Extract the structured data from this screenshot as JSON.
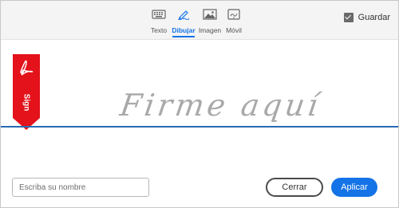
{
  "tabs": [
    {
      "label": "Texto",
      "icon": "keyboard-icon"
    },
    {
      "label": "Dibujar",
      "icon": "pen-icon",
      "active": true
    },
    {
      "label": "Imagen",
      "icon": "image-icon"
    },
    {
      "label": "Móvil",
      "icon": "mobile-icon"
    }
  ],
  "save": {
    "label": "Guardar",
    "checked": true
  },
  "canvas": {
    "hint": "Firme aquí",
    "ribbon_label": "Sign",
    "ribbon_icon": "acrobat-icon"
  },
  "name_field": {
    "placeholder": "Escriba su nombre"
  },
  "actions": {
    "close_label": "Cerrar",
    "apply_label": "Aplicar"
  },
  "colors": {
    "accent": "#1473e6",
    "ribbon": "#e3121b",
    "line": "#2a6ab5"
  }
}
